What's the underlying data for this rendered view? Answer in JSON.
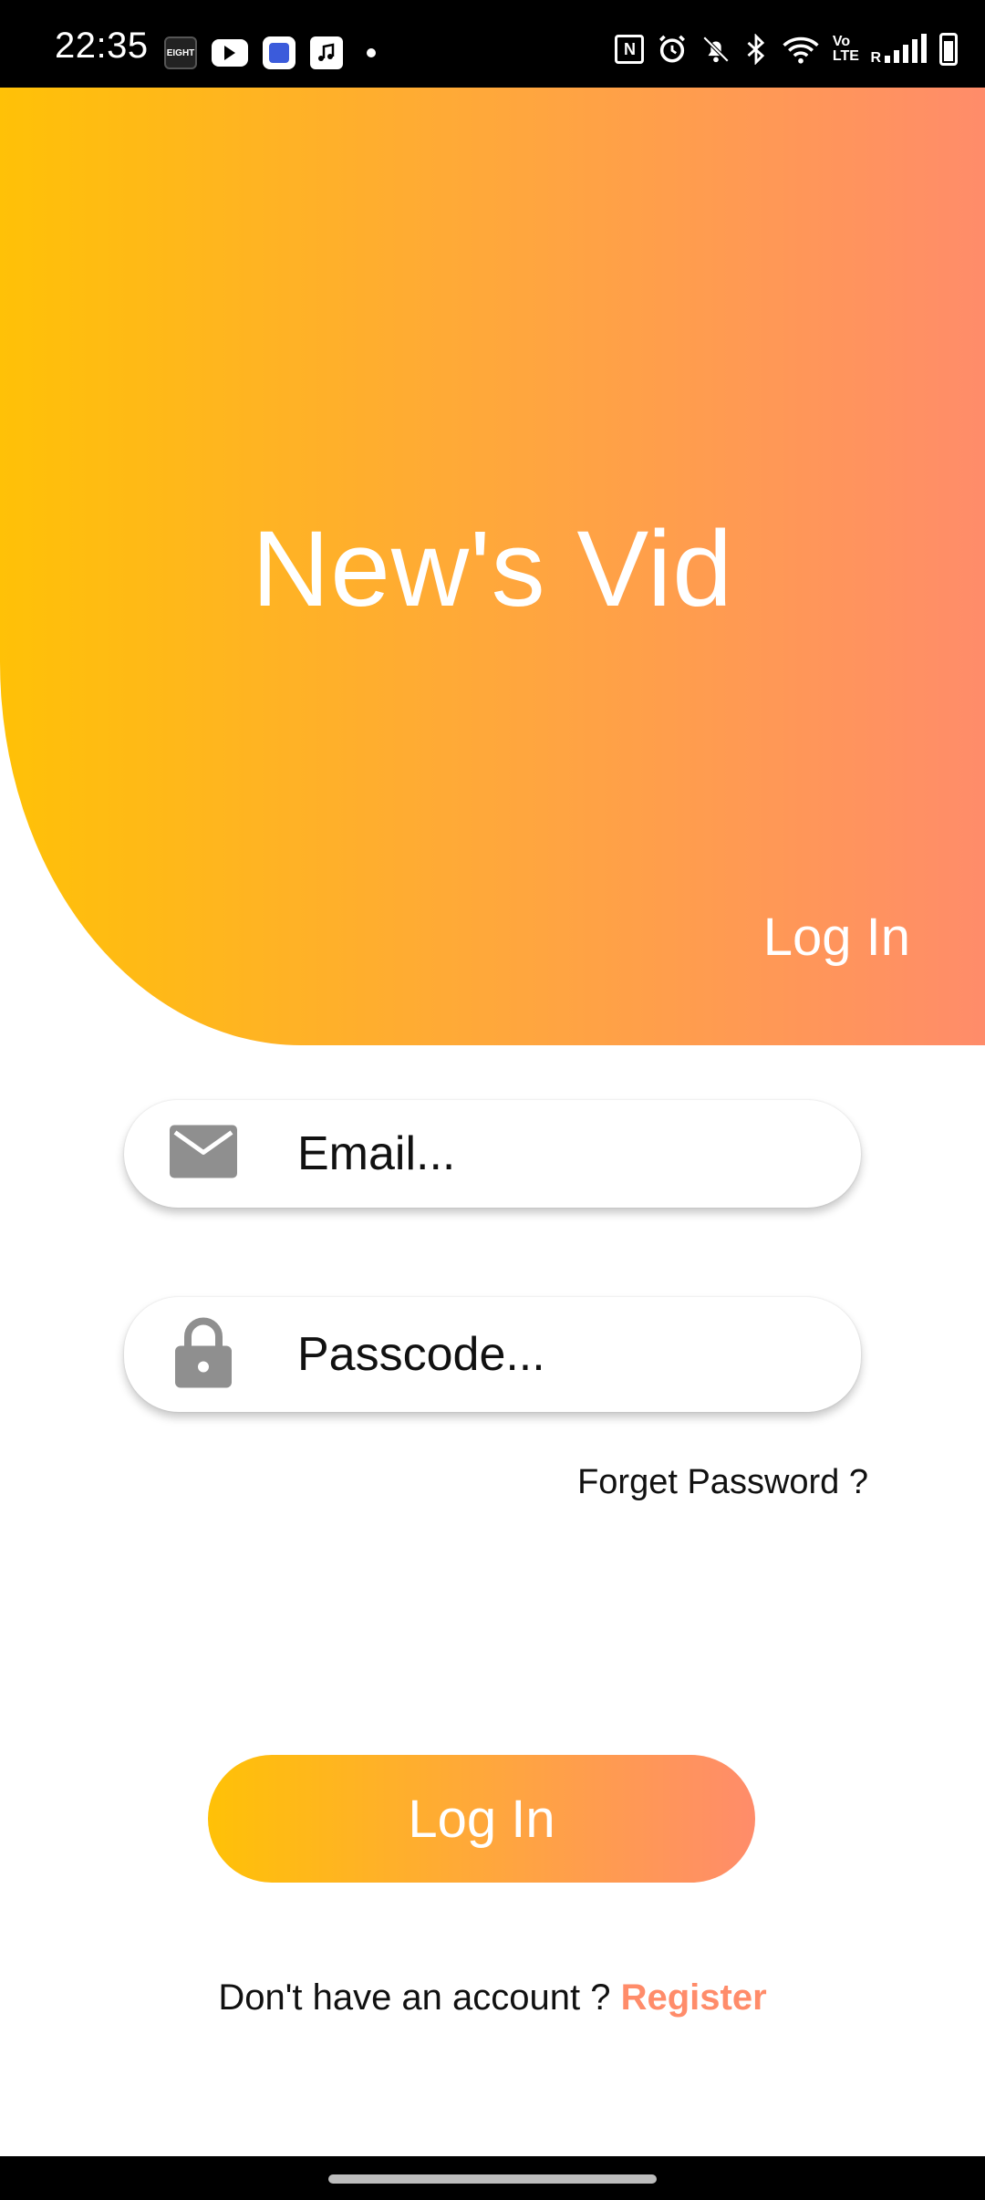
{
  "status_bar": {
    "time": "22:35",
    "left_icons": [
      "eight-app-icon",
      "youtube-icon",
      "store-app-icon",
      "music-app-icon",
      "notification-dot-icon"
    ],
    "right_icons": [
      "nfc-icon",
      "alarm-icon",
      "bell-muted-icon",
      "bluetooth-icon",
      "wifi-icon",
      "volte-icon",
      "signal-icon",
      "battery-icon"
    ],
    "eight_label": "EIGHT",
    "volte_label": "Vo LTE",
    "roaming_label": "R"
  },
  "header": {
    "app_title": "New's Vid",
    "screen_title": "Log In"
  },
  "form": {
    "email_placeholder": "Email...",
    "passcode_placeholder": "Passcode...",
    "forget_password": "Forget Password ?",
    "login_button": "Log In"
  },
  "footer": {
    "no_account_text": "Don't have an account ?",
    "register_link": "Register"
  },
  "colors": {
    "gradient_start": "#ffc107",
    "gradient_end": "#ff8c6a",
    "icon_gray": "#8f8f8f",
    "register_color": "#ff8c6a"
  }
}
